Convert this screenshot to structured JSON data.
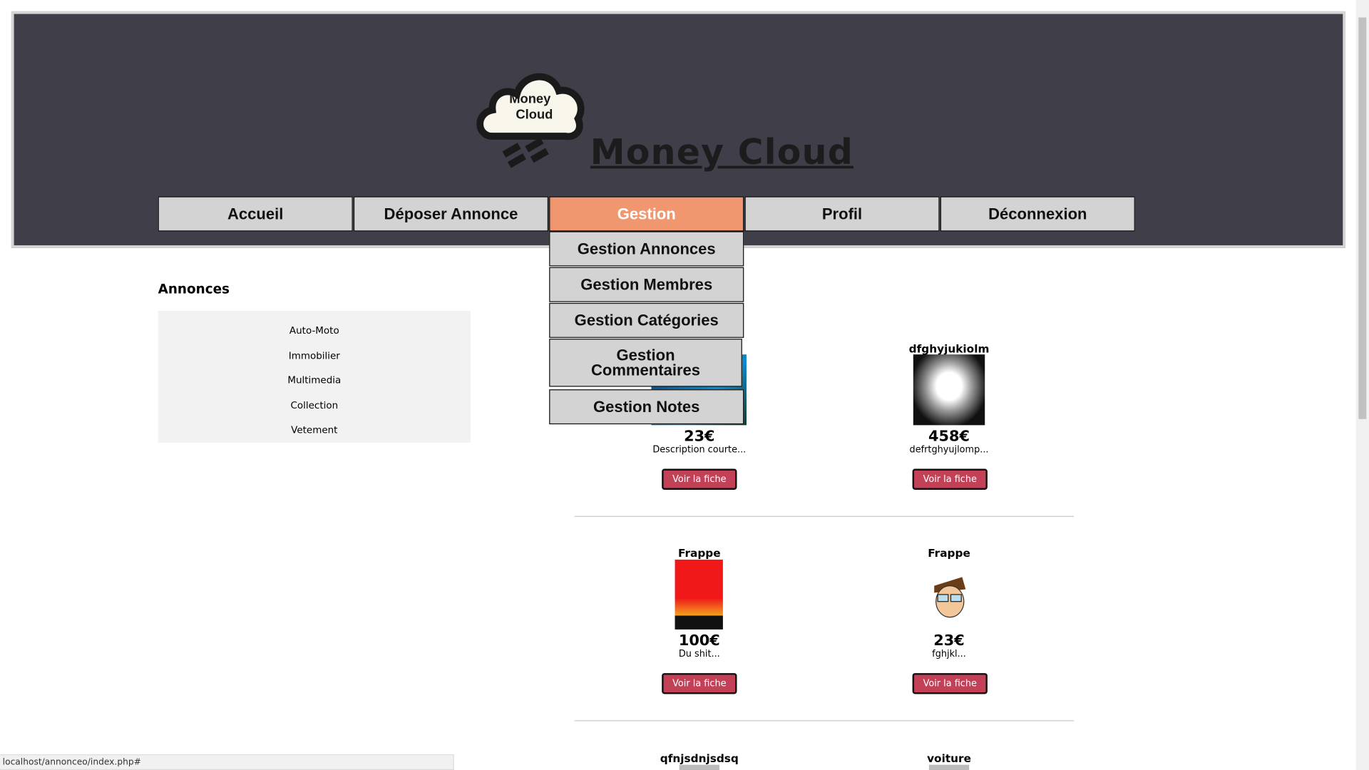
{
  "header": {
    "logo_text": "Money Cloud",
    "title": "Money Cloud"
  },
  "nav": [
    {
      "label": "Accueil"
    },
    {
      "label": "Déposer Annonce"
    },
    {
      "label": "Gestion",
      "active": true
    },
    {
      "label": "Profil"
    },
    {
      "label": "Déconnexion"
    }
  ],
  "gestion_menu": [
    {
      "label": "Gestion Annonces"
    },
    {
      "label": "Gestion Membres"
    },
    {
      "label": "Gestion Catégories"
    },
    {
      "label": "Gestion Commentaires"
    },
    {
      "label": "Gestion Notes"
    }
  ],
  "sidebar": {
    "heading": "Annonces",
    "categories": [
      "Auto-Moto",
      "Immobilier",
      "Multimedia",
      "Collection",
      "Vetement"
    ]
  },
  "listings": [
    {
      "title": "",
      "price": "23€",
      "description": "Description courte...",
      "button": "Voir la fiche"
    },
    {
      "title": "dfghyjukiolm",
      "price": "458€",
      "description": "defrtghyujlomp...",
      "button": "Voir la fiche"
    },
    {
      "title": "Frappe",
      "price": "100€",
      "description": "Du shit...",
      "button": "Voir la fiche"
    },
    {
      "title": "Frappe",
      "price": "23€",
      "description": "fghjkl...",
      "button": "Voir la fiche"
    },
    {
      "title": "qfnjsdnjsdsq"
    },
    {
      "title": "voiture"
    }
  ],
  "status_bar": "localhost/annonceo/index.php#",
  "colors": {
    "header_bg": "#403e48",
    "active_nav": "#f0976f",
    "button": "#c34157",
    "sidebar_bg": "#f2f2f2"
  }
}
